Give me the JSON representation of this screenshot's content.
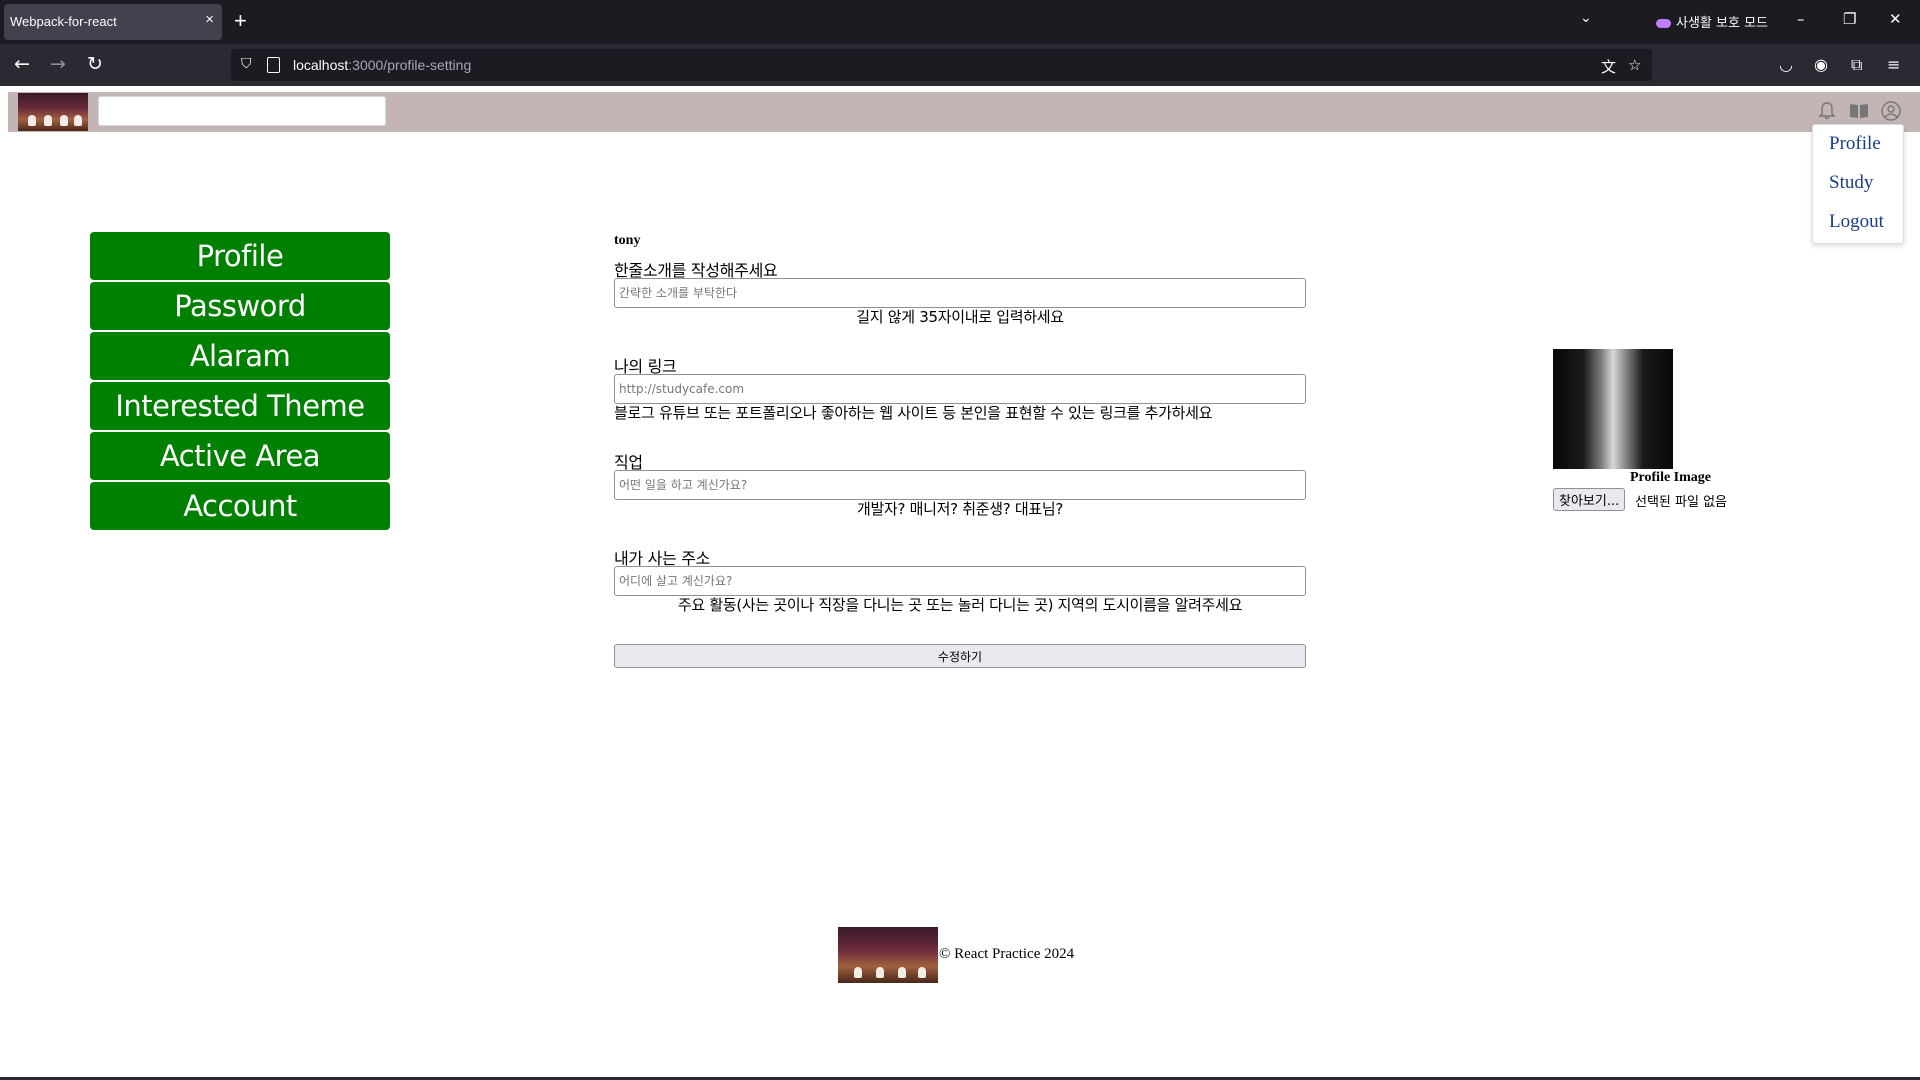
{
  "browser": {
    "tab_title": "Webpack-for-react",
    "tab_close": "×",
    "new_tab": "+",
    "private_label": "사생활 보호 모드",
    "url_host": "localhost",
    "url_path": ":3000/profile-setting"
  },
  "sidebar": {
    "items": [
      {
        "label": "Profile"
      },
      {
        "label": "Password"
      },
      {
        "label": "Alaram"
      },
      {
        "label": "Interested Theme"
      },
      {
        "label": "Active Area"
      },
      {
        "label": "Account"
      }
    ]
  },
  "user_menu": {
    "items": [
      {
        "label": "Profile"
      },
      {
        "label": "Study"
      },
      {
        "label": "Logout"
      }
    ]
  },
  "form": {
    "username": "tony",
    "bio": {
      "label": "한줄소개를 작성해주세요",
      "placeholder": "간략한 소개를 부탁한다",
      "hint": "길지 않게 35자이내로 입력하세요"
    },
    "link": {
      "label": "나의 링크",
      "placeholder": "http://studycafe.com",
      "hint": "블로그 유튜브 또는 포트폴리오나 좋아하는 웹 사이트 등 본인을 표현할 수 있는 링크를 추가하세요"
    },
    "job": {
      "label": "직업",
      "placeholder": "어떤 일을 하고 계신가요?",
      "hint": "개발자? 매니저? 취준생? 대표님?"
    },
    "address": {
      "label": "내가 사는 주소",
      "placeholder": "어디에 살고 계신가요?",
      "hint": "주요 활동(사는 곳이나 직장을 다니는 곳 또는 놀러 다니는 곳) 지역의 도시이름을 알려주세요"
    },
    "submit_label": "수정하기"
  },
  "profile_image": {
    "label": "Profile Image",
    "browse_label": "찾아보기...",
    "no_file": "선택된 파일 없음"
  },
  "footer": {
    "text": "© React Practice 2024"
  },
  "colors": {
    "header_bg": "#c4b5b5",
    "sidebar_button": "#008000",
    "menu_link": "#1a3d8a"
  }
}
